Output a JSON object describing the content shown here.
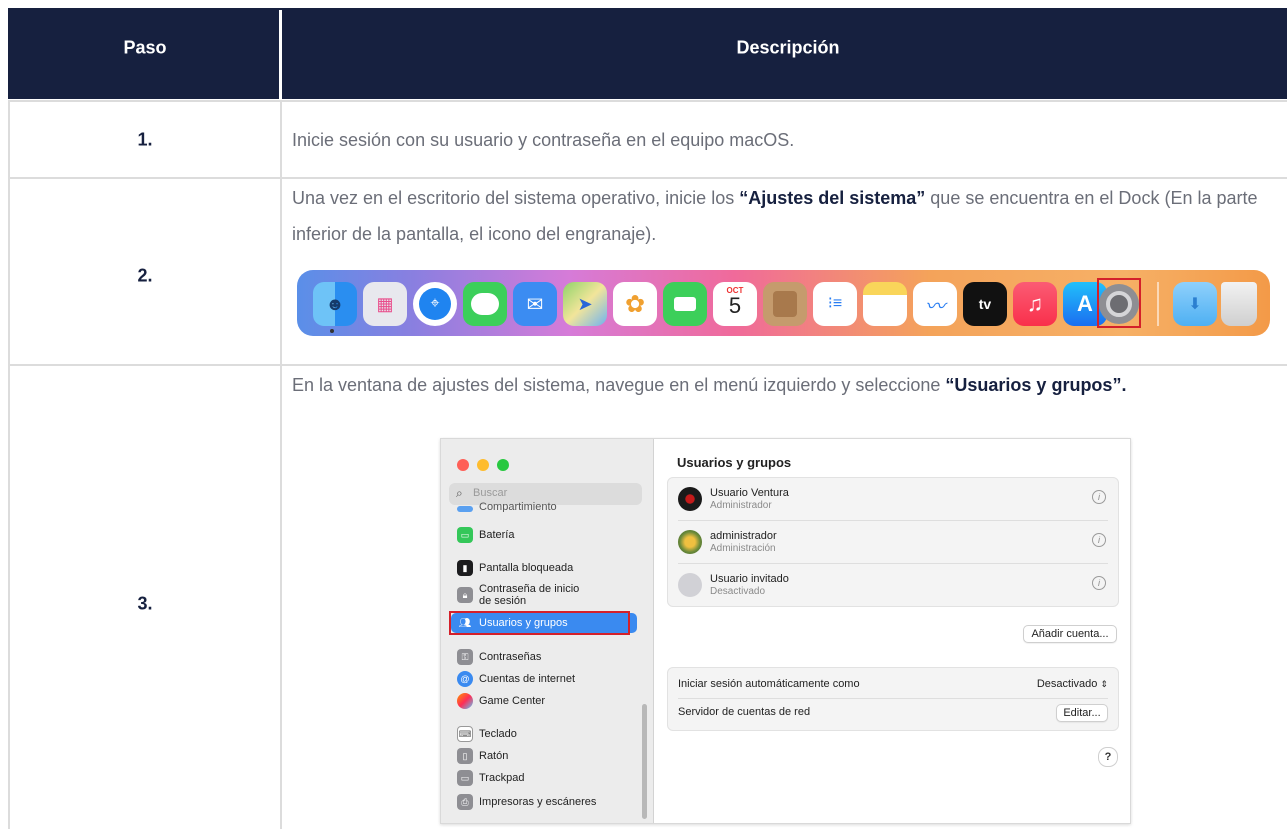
{
  "table": {
    "header": {
      "step": "Paso",
      "description": "Descripción"
    },
    "rows": [
      {
        "step": "1.",
        "text": "Inicie sesión con su usuario y contraseña en el equipo macOS."
      },
      {
        "step": "2.",
        "text_before": "Una vez en el escritorio del sistema operativo, inicie los ",
        "bold": "“Ajustes del sistema”",
        "text_after": " que se encuentra en el Dock (En la parte inferior de la pantalla, el icono del engranaje)."
      },
      {
        "step": "3.",
        "text_before": "En la ventana de ajustes del sistema, navegue en el menú izquierdo y seleccione ",
        "bold": "“Usuarios y grupos”.",
        "text_after": ""
      }
    ]
  },
  "dock": {
    "icons": [
      "finder-icon",
      "launchpad-icon",
      "safari-icon",
      "messages-icon",
      "mail-icon",
      "maps-icon",
      "photos-icon",
      "facetime-icon",
      "calendar-icon",
      "contacts-icon",
      "reminders-icon",
      "notes-icon",
      "freeform-icon",
      "appletv-icon",
      "music-icon",
      "appstore-icon",
      "system-settings-icon",
      "downloads-folder-icon",
      "trash-icon"
    ],
    "calendar_month": "OCT",
    "calendar_day": "5",
    "tv_label": "tv"
  },
  "settings": {
    "search_placeholder": "Buscar",
    "sidebar": {
      "partial_item": "Compartimiento",
      "items": [
        {
          "label": "Batería",
          "icon": "battery-icon",
          "color": "#34c759"
        },
        {
          "label": "Pantalla bloqueada",
          "icon": "lock-screen-icon",
          "color": "#1c1c1e"
        },
        {
          "label": "Contraseña de inicio de sesión",
          "label_line1": "Contraseña de inicio",
          "label_line2": "de sesión",
          "icon": "login-password-icon",
          "color": "#8e8e93"
        },
        {
          "label": "Usuarios y grupos",
          "icon": "users-groups-icon",
          "color": "#3a8af0"
        },
        {
          "label": "Contraseñas",
          "icon": "passwords-icon",
          "color": "#8e8e93"
        },
        {
          "label": "Cuentas de internet",
          "icon": "internet-accounts-icon",
          "color": "#3a8af0"
        },
        {
          "label": "Game Center",
          "icon": "game-center-icon",
          "color": "#ff9500"
        },
        {
          "label": "Teclado",
          "icon": "keyboard-icon",
          "color": "#8e8e93"
        },
        {
          "label": "Ratón",
          "icon": "mouse-icon",
          "color": "#8e8e93"
        },
        {
          "label": "Trackpad",
          "icon": "trackpad-icon",
          "color": "#8e8e93"
        },
        {
          "label": "Impresoras y escáneres",
          "icon": "printers-icon",
          "color": "#8e8e93"
        }
      ]
    },
    "main": {
      "title": "Usuarios y grupos",
      "users": [
        {
          "name": "Usuario Ventura",
          "role": "Administrador"
        },
        {
          "name": "administrador",
          "role": "Administración"
        },
        {
          "name": "Usuario invitado",
          "role": "Desactivado"
        }
      ],
      "add_account": "Añadir cuenta...",
      "auto_login_label": "Iniciar sesión automáticamente como",
      "auto_login_value": "Desactivado",
      "network_server_label": "Servidor de cuentas de red",
      "edit_button": "Editar...",
      "help": "?"
    }
  }
}
